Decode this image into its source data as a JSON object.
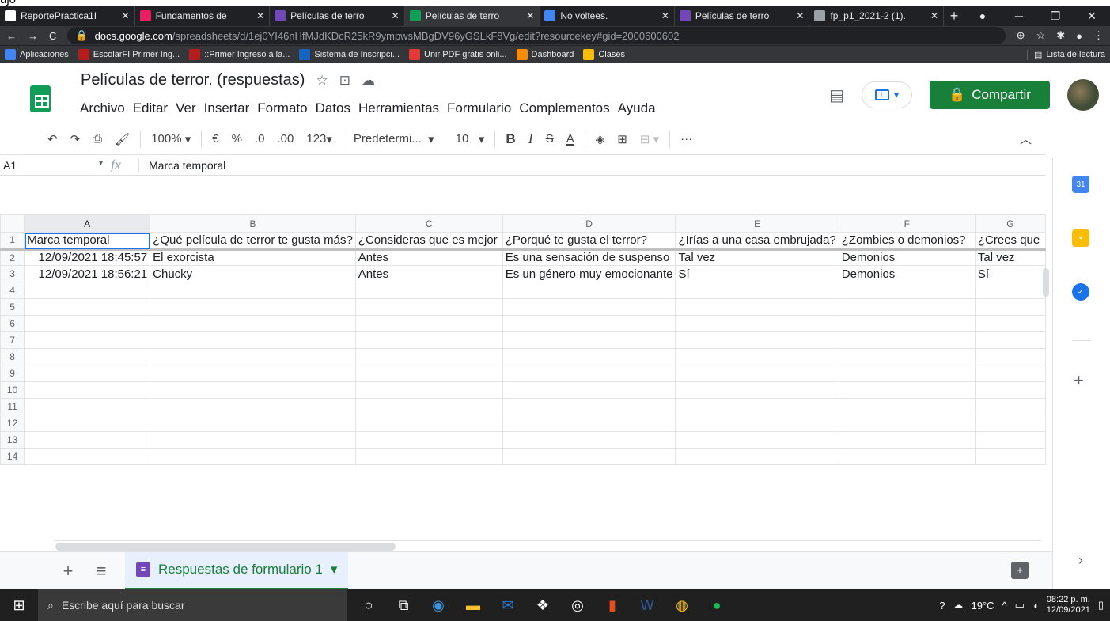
{
  "tabs": [
    {
      "label": "ReportePractica1I",
      "icon": "github-icon",
      "color": "#ffffff"
    },
    {
      "label": "Fundamentos de",
      "icon": "classroom-icon",
      "color": "#e91e63"
    },
    {
      "label": "Películas de terro",
      "icon": "forms-icon",
      "color": "#7248b9"
    },
    {
      "label": "Películas de terro",
      "icon": "sheets-icon",
      "color": "#0f9d58",
      "active": true
    },
    {
      "label": "No voltees.",
      "icon": "form-icon",
      "color": "#4285f4"
    },
    {
      "label": "Películas de terro",
      "icon": "forms-icon",
      "color": "#7248b9"
    },
    {
      "label": "fp_p1_2021-2 (1).",
      "icon": "globe-icon",
      "color": "#9aa0a6"
    }
  ],
  "url": {
    "host": "docs.google.com",
    "path": "/spreadsheets/d/1ej0YI46nHfMJdKDcR25kR9ympwsMBgDV96yGSLkF8Vg/edit?resourcekey#gid=2000600602"
  },
  "bookmarks": [
    {
      "label": "Aplicaciones",
      "color": "#4285f4"
    },
    {
      "label": "EscolarFI Primer Ing...",
      "color": "#b71c1c"
    },
    {
      "label": "::Primer Ingreso a la...",
      "color": "#b71c1c"
    },
    {
      "label": "Sistema de Inscripci...",
      "color": "#1565c0"
    },
    {
      "label": "Unir PDF gratis onli...",
      "color": "#e53935"
    },
    {
      "label": "Dashboard",
      "color": "#fb8c00"
    },
    {
      "label": "Clases",
      "color": "#fbbc04"
    }
  ],
  "reading_list": "Lista de lectura",
  "doc": {
    "title": "Películas de terror. (respuestas)",
    "menu": [
      "Archivo",
      "Editar",
      "Ver",
      "Insertar",
      "Formato",
      "Datos",
      "Herramientas",
      "Formulario",
      "Complementos",
      "Ayuda"
    ],
    "share_label": "Compartir"
  },
  "toolbar": {
    "zoom": "100%",
    "currency": "€",
    "percent": "%",
    "dec_less": ".0",
    "dec_more": ".00",
    "format": "123",
    "font": "Predetermi...",
    "size": "10"
  },
  "formula": {
    "cell": "A1",
    "value": "Marca temporal"
  },
  "columns": [
    "A",
    "B",
    "C",
    "D",
    "E",
    "F",
    "G"
  ],
  "rows": [
    [
      "Marca temporal",
      "¿Qué película de terror te gusta más?",
      "¿Consideras que es mejor",
      "¿Porqué te gusta el terror?",
      "¿Irías a una casa embrujada?",
      "¿Zombies o demonios?",
      "¿Crees que"
    ],
    [
      "12/09/2021 18:45:57",
      "El exorcista",
      "Antes",
      "Es una sensación de suspenso",
      "Tal vez",
      "Demonios",
      "Tal vez"
    ],
    [
      "12/09/2021 18:56:21",
      "Chucky",
      "Antes",
      "Es un género muy emocionante",
      "Sí",
      "Demonios",
      "Sí"
    ],
    [
      "",
      "",
      "",
      "",
      "",
      "",
      ""
    ],
    [
      "",
      "",
      "",
      "",
      "",
      "",
      ""
    ],
    [
      "",
      "",
      "",
      "",
      "",
      "",
      ""
    ],
    [
      "",
      "",
      "",
      "",
      "",
      "",
      ""
    ],
    [
      "",
      "",
      "",
      "",
      "",
      "",
      ""
    ],
    [
      "",
      "",
      "",
      "",
      "",
      "",
      ""
    ],
    [
      "",
      "",
      "",
      "",
      "",
      "",
      ""
    ],
    [
      "",
      "",
      "",
      "",
      "",
      "",
      ""
    ],
    [
      "",
      "",
      "",
      "",
      "",
      "",
      ""
    ],
    [
      "",
      "",
      "",
      "",
      "",
      "",
      ""
    ],
    [
      "",
      "",
      "",
      "",
      "",
      "",
      ""
    ]
  ],
  "sheet_tab": "Respuestas de formulario 1",
  "taskbar": {
    "search_placeholder": "Escribe aquí para buscar",
    "temp": "19°C",
    "time": "08:22 p. m.",
    "date": "12/09/2021"
  }
}
